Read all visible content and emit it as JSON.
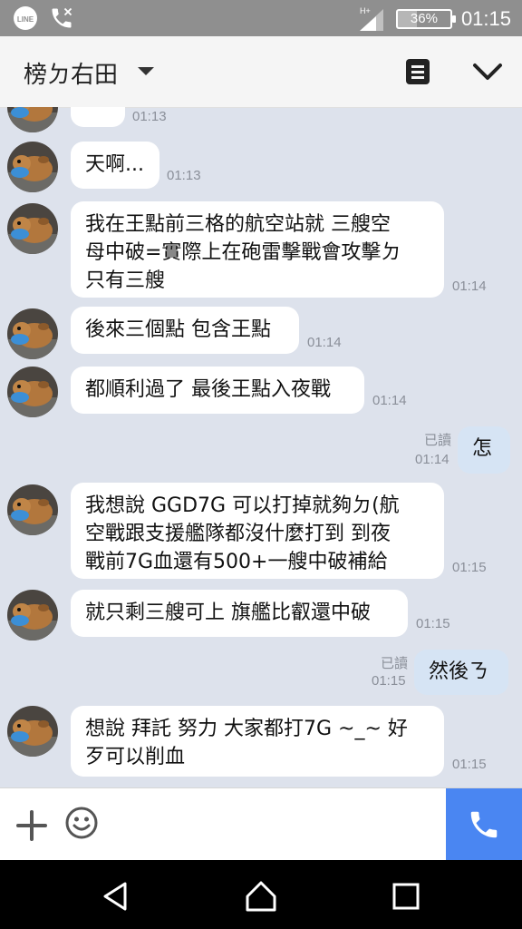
{
  "status_bar": {
    "time": "01:15",
    "battery": "36%",
    "network": "H+",
    "battery_level": 0.36
  },
  "header": {
    "title": "榜ㄉ右田"
  },
  "messages": [
    {
      "dir": "in",
      "text": "\"\"",
      "time": "01:13"
    },
    {
      "dir": "in",
      "text": "天啊...",
      "time": "01:13"
    },
    {
      "dir": "in",
      "text": "我在王點前三格的航空站就 三艘空\n母中破=實際上在砲雷擊戰會攻擊ㄉ\n只有三艘",
      "time": "01:14"
    },
    {
      "dir": "in",
      "text": "後來三個點 包含王點",
      "time": "01:14"
    },
    {
      "dir": "in",
      "text": "都順利過了 最後王點入夜戰",
      "time": "01:14"
    },
    {
      "dir": "out",
      "text": "怎",
      "time": "01:14",
      "read": "已讀"
    },
    {
      "dir": "in",
      "text": "我想說 GGD7G 可以打掉就夠ㄉ(航\n空戰跟支援艦隊都沒什麼打到 到夜\n戰前7G血還有500+一艘中破補給",
      "time": "01:15"
    },
    {
      "dir": "in",
      "text": "就只剩三艘可上 旗艦比叡還中破",
      "time": "01:15"
    },
    {
      "dir": "out",
      "text": "然後ㄋ",
      "time": "01:15",
      "read": "已讀"
    },
    {
      "dir": "in",
      "text": "想說 拜託 努力 大家都打7G ~_~ 好\n歹可以削血",
      "time": "01:15"
    }
  ],
  "colors": {
    "accent": "#4a86f2",
    "chat_bg": "#dde2ec",
    "outgoing_bubble": "#d6e4f4"
  }
}
